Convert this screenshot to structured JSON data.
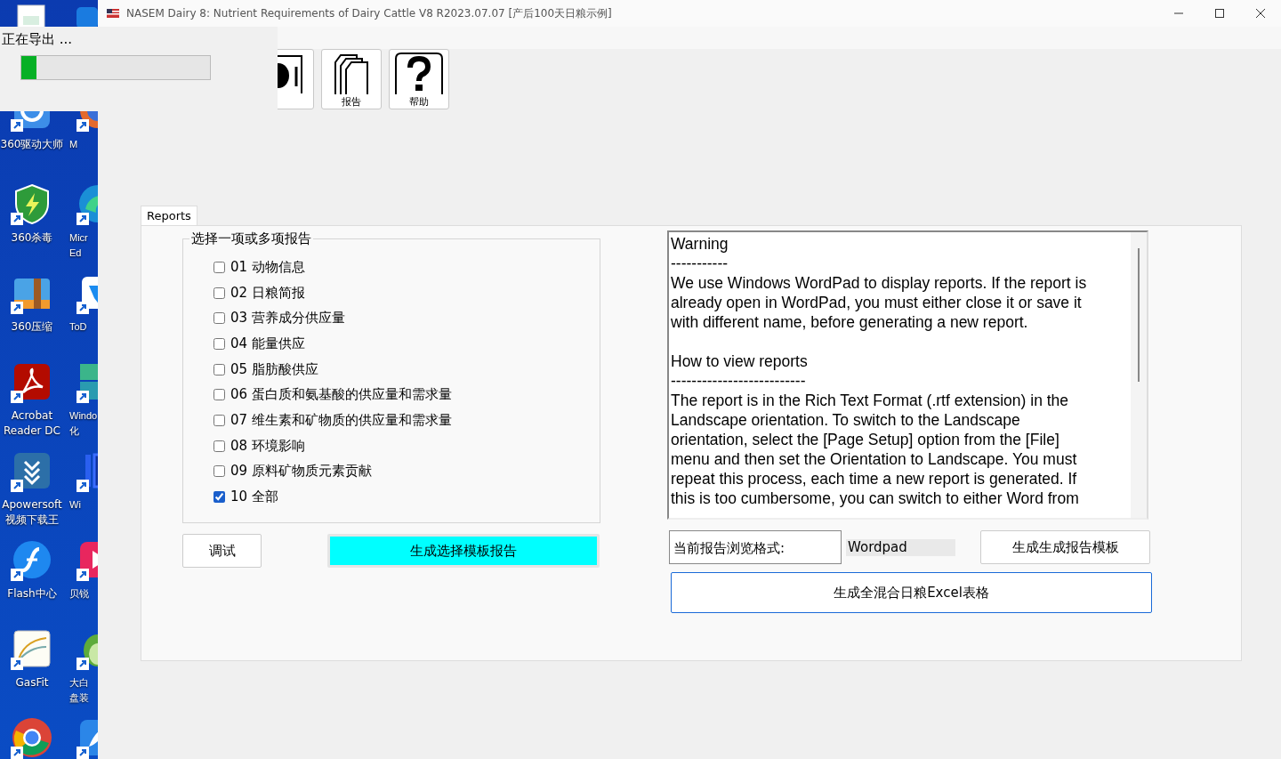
{
  "desktop": {
    "icons": [
      {
        "lines": [
          "360驱动大师"
        ]
      },
      {
        "lines": [
          "360杀毒"
        ]
      },
      {
        "lines": [
          "360压缩"
        ]
      },
      {
        "lines": [
          "Acrobat",
          "Reader DC"
        ]
      },
      {
        "lines": [
          "Apowersoft",
          "视频下载王"
        ]
      },
      {
        "lines": [
          "Flash中心"
        ]
      },
      {
        "lines": [
          "GasFit"
        ]
      }
    ],
    "icons_cut": [
      {
        "lines": [
          "M"
        ]
      },
      {
        "lines": [
          "Micr",
          "Ed"
        ]
      },
      {
        "lines": [
          "ToD"
        ]
      },
      {
        "lines": [
          "Windo",
          "化"
        ]
      },
      {
        "lines": [
          "Wi"
        ]
      },
      {
        "lines": [
          "贝锐"
        ]
      },
      {
        "lines": [
          "大白",
          "盘装"
        ]
      }
    ]
  },
  "export_dialog": {
    "message": "正在导出 ...",
    "progress": {
      "level": 0.08
    }
  },
  "window": {
    "title": "NASEM Dairy 8: Nutrient Requirements of Dairy Cattle  V8 R2023.07.07 [产后100天日粮示例]"
  },
  "toolbar": [
    {
      "kind": "ration"
    },
    {
      "kind": "report",
      "label": "报告"
    },
    {
      "kind": "help",
      "label": "帮助"
    }
  ],
  "tabs": [
    {
      "label": "Reports",
      "selected": true
    }
  ],
  "report_group": {
    "title": "选择一项或多项报告",
    "items": [
      {
        "label": "01 动物信息",
        "checked": false
      },
      {
        "label": "02 日粮简报",
        "checked": false
      },
      {
        "label": "03 营养成分供应量",
        "checked": false
      },
      {
        "label": "04 能量供应",
        "checked": false
      },
      {
        "label": "05 脂肪酸供应",
        "checked": false
      },
      {
        "label": "06 蛋白质和氨基酸的供应量和需求量",
        "checked": false
      },
      {
        "label": "07 维生素和矿物质的供应量和需求量",
        "checked": false
      },
      {
        "label": "08 环境影响",
        "checked": false
      },
      {
        "label": "09 原料矿物质元素贡献",
        "checked": false
      },
      {
        "label": "10 全部",
        "checked": true
      }
    ]
  },
  "debug_button": "调试",
  "generate_button": "生成选择模板报告",
  "info_text": [
    [
      "Warning",
      "-----------",
      "We use Windows WordPad to display reports. If the report is",
      "already open in WordPad, you must either close it or save it",
      "with different name, before generating a new report."
    ],
    [
      "How to view reports",
      "--------------------------",
      "The report is in the Rich Text Format (.rtf extension) in the",
      "Landscape orientation. To switch to the Landscape",
      "orientation, select the [Page Setup] option from the [File]",
      "menu and then set the Orientation to Landscape. You must",
      "repeat this process, each time a new report is generated. If",
      "this is too cumbersome, you can switch to either Word from"
    ]
  ],
  "viewer_label": "当前报告浏览格式:",
  "viewer_value": "Wordpad",
  "template_button": "生成生成报告模板",
  "excel_button": "生成全混合日粮Excel表格"
}
